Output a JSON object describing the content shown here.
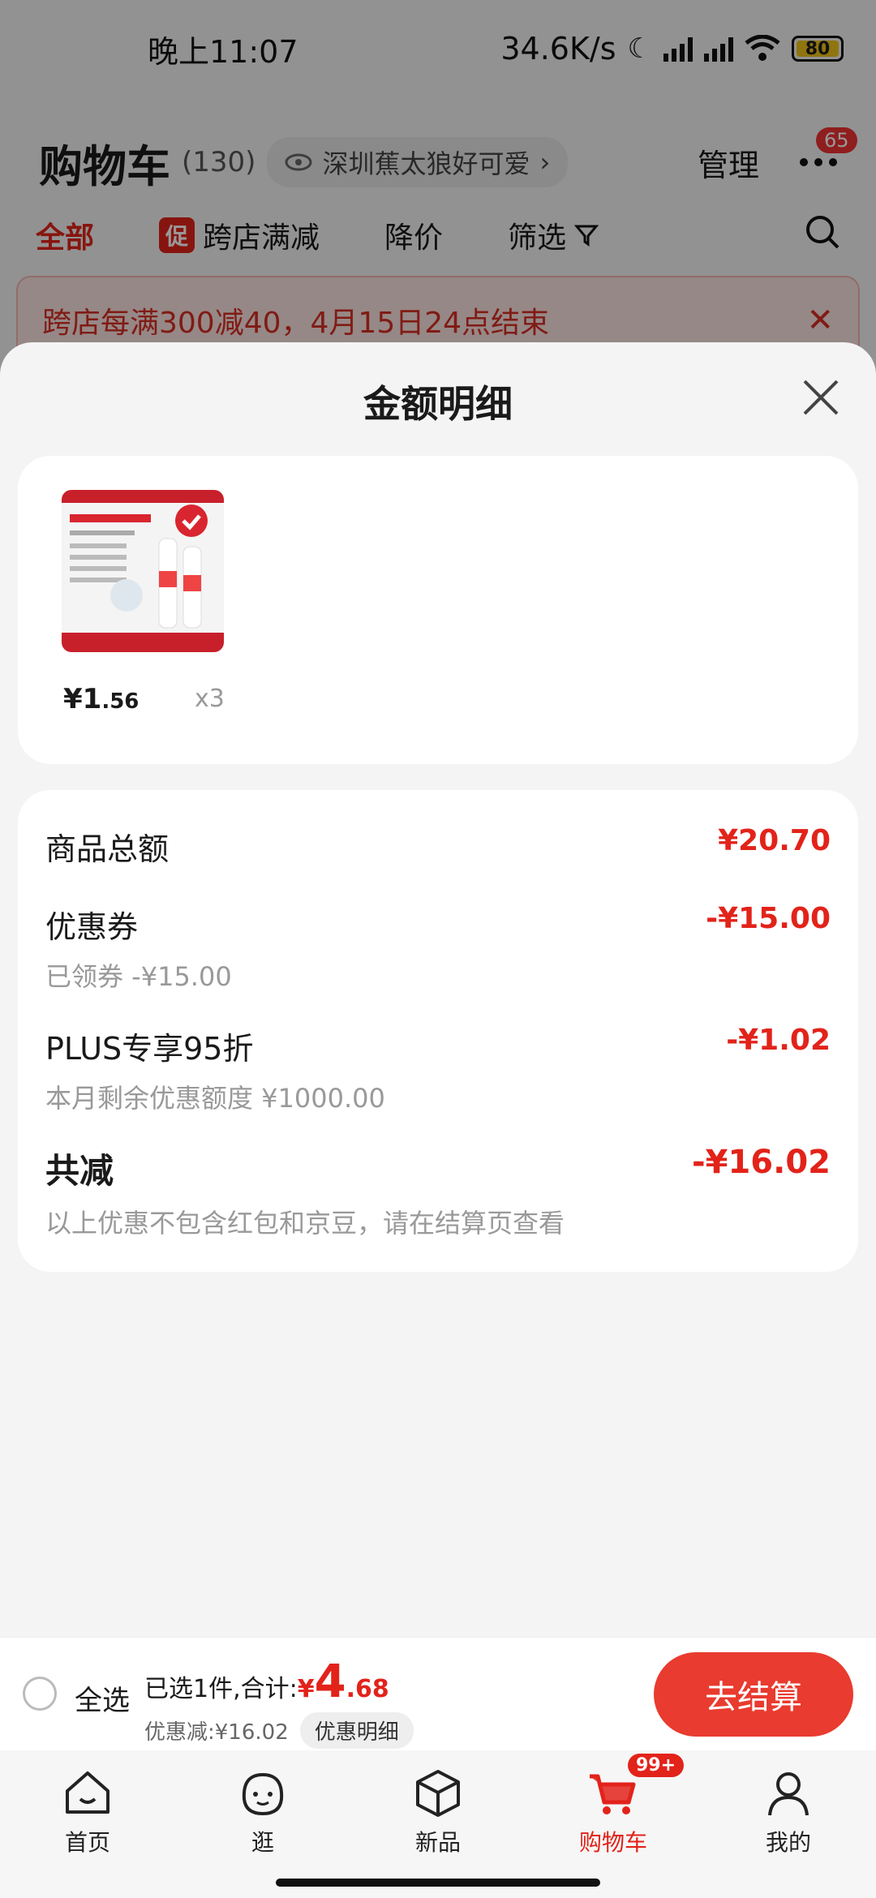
{
  "status_bar": {
    "time": "晚上11:07",
    "network_speed": "34.6K/s",
    "battery": "80"
  },
  "header": {
    "title": "购物车",
    "count": "(130)",
    "address": "深圳蕉太狼好可爱",
    "manage": "管理",
    "more_badge": "65"
  },
  "tabs": [
    {
      "label": "全部",
      "active": true
    },
    {
      "label": "跨店满减",
      "tag": "促"
    },
    {
      "label": "降价"
    },
    {
      "label": "筛选"
    }
  ],
  "promo_banner": {
    "text": "跨店每满300减40，4月15日24点结束"
  },
  "sheet": {
    "title": "金额明细",
    "product": {
      "price_int": "¥1",
      "price_dec": ".56",
      "qty": "x3"
    },
    "details": {
      "goods_total_label": "商品总额",
      "goods_total_value": "¥20.70",
      "coupon_label": "优惠券",
      "coupon_sub": "已领券 -¥15.00",
      "coupon_value": "-¥15.00",
      "plus_label": "PLUS专享95折",
      "plus_sub": "本月剩余优惠额度 ¥1000.00",
      "plus_value": "-¥1.02",
      "total_label": "共减",
      "total_sub": "以上优惠不包含红包和京豆，请在结算页查看",
      "total_value": "-¥16.02"
    }
  },
  "checkout": {
    "select_all": "全选",
    "selected_prefix": "已选1件,合计:",
    "currency": "¥",
    "total_int": "4",
    "total_dec": ".68",
    "discount_text": "优惠减:¥16.02",
    "detail_button": "优惠明细",
    "checkout_button": "去结算"
  },
  "bottom_nav": {
    "items": [
      {
        "label": "首页",
        "icon": "home-icon"
      },
      {
        "label": "逛",
        "icon": "browse-face-icon"
      },
      {
        "label": "新品",
        "icon": "cube-icon"
      },
      {
        "label": "购物车",
        "icon": "cart-icon",
        "badge": "99+",
        "active": true
      },
      {
        "label": "我的",
        "icon": "user-icon"
      }
    ]
  },
  "colors": {
    "accent": "#e2231a",
    "checkout_button": "#e93b2f",
    "banner_bg": "#fbe3e0"
  }
}
